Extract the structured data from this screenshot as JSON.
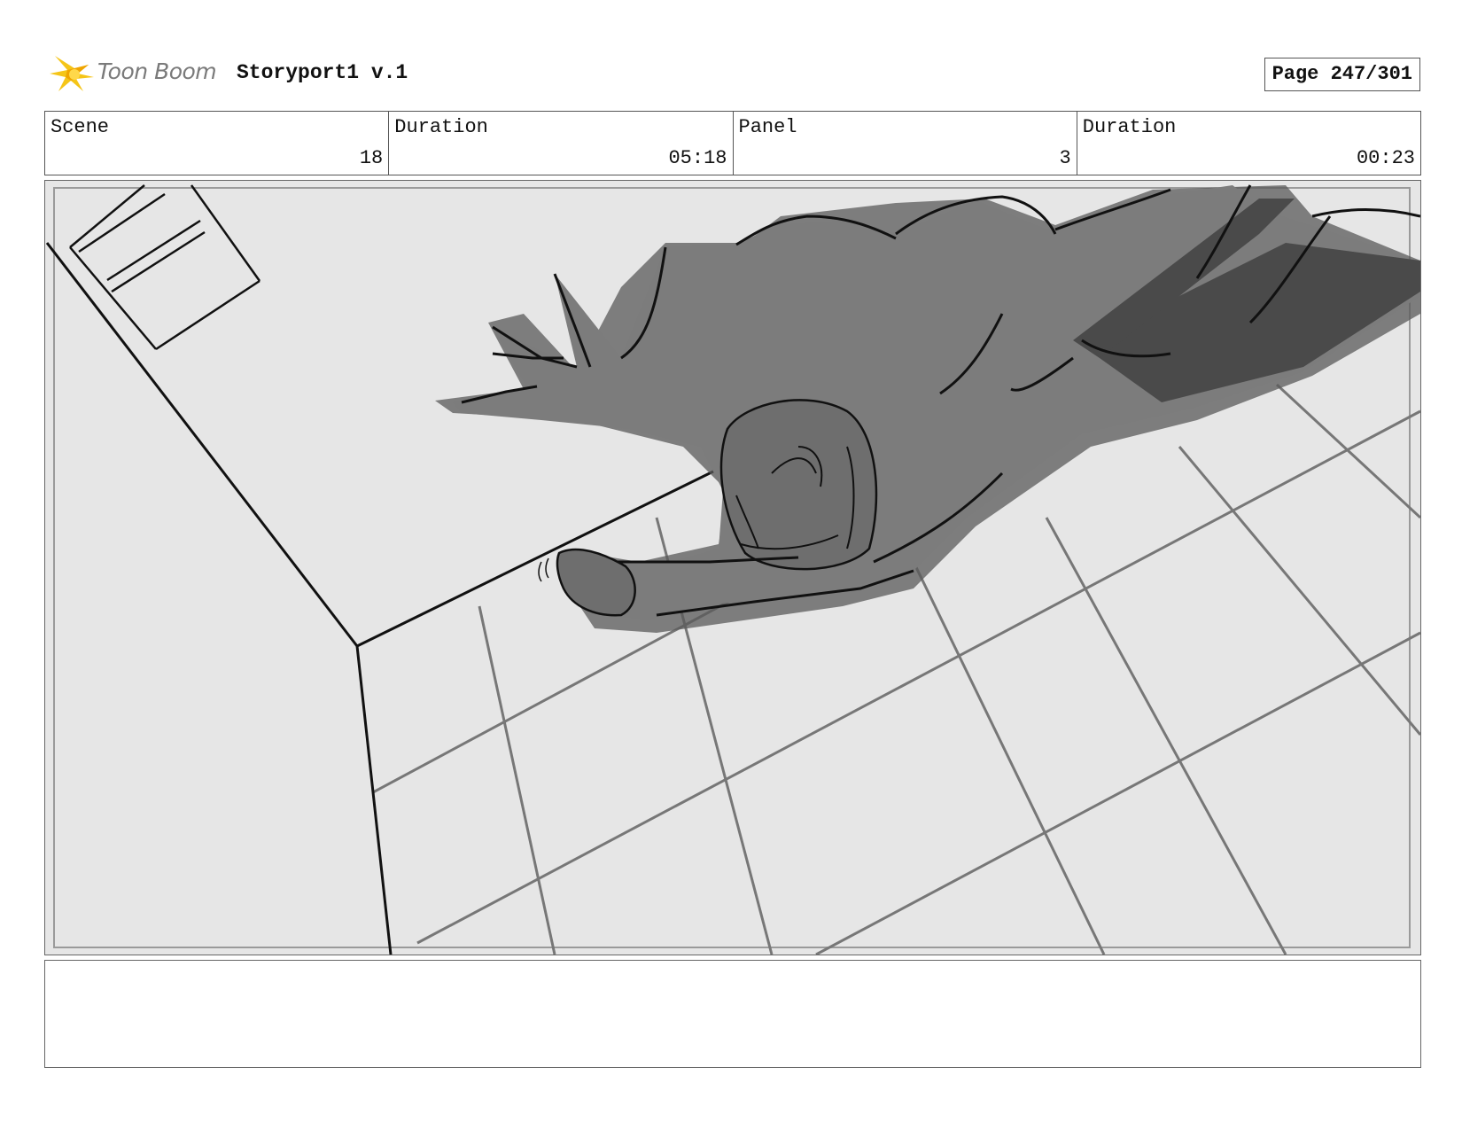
{
  "header": {
    "logo_text": "Toon Boom",
    "doc_title": "Storyport1 v.1",
    "page_label": "Page 247/301"
  },
  "info": [
    {
      "label": "Scene",
      "value": "18"
    },
    {
      "label": "Duration",
      "value": "05:18"
    },
    {
      "label": "Panel",
      "value": "3"
    },
    {
      "label": "Duration",
      "value": "00:23"
    }
  ],
  "notes": ""
}
